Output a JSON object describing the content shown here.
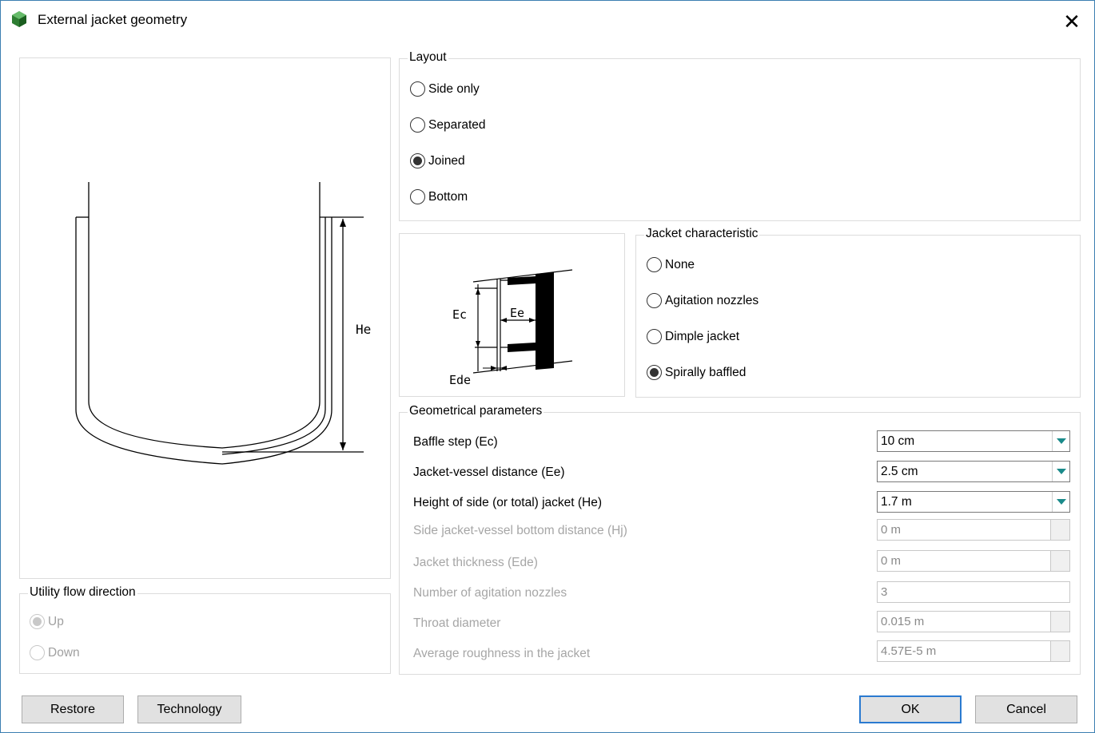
{
  "window": {
    "title": "External jacket geometry",
    "close_glyph": "✕"
  },
  "diagram_main": {
    "label_he": "He"
  },
  "diagram_detail": {
    "label_ec": "Ec",
    "label_ee": "Ee",
    "label_ede": "Ede"
  },
  "layout": {
    "title": "Layout",
    "options": [
      "Side only",
      "Separated",
      "Joined",
      "Bottom"
    ],
    "selected": "Joined"
  },
  "jacket_characteristic": {
    "title": "Jacket characteristic",
    "options": [
      "None",
      "Agitation nozzles",
      "Dimple jacket",
      "Spirally baffled"
    ],
    "selected": "Spirally baffled"
  },
  "utility_flow": {
    "title": "Utility flow direction",
    "options": [
      "Up",
      "Down"
    ],
    "selected": "Up"
  },
  "geometrical": {
    "title": "Geometrical parameters",
    "params": [
      {
        "label": "Baffle step (Ec)",
        "value": "10 cm"
      },
      {
        "label": "Jacket-vessel distance (Ee)",
        "value": "2.5 cm"
      },
      {
        "label": "Height of side (or total) jacket (He)",
        "value": "1.7 m"
      },
      {
        "label": "Side jacket-vessel bottom distance (Hj)",
        "value": "0 m"
      },
      {
        "label": "Jacket thickness (Ede)",
        "value": "0 m"
      },
      {
        "label": "Number of agitation nozzles",
        "value": "3"
      },
      {
        "label": "Throat diameter",
        "value": "0.015 m"
      },
      {
        "label": "Average roughness in the jacket",
        "value": "4.57E-5 m"
      }
    ]
  },
  "buttons": {
    "restore": "Restore",
    "technology": "Technology",
    "ok": "OK",
    "cancel": "Cancel"
  },
  "colors": {
    "accent": "#2a7ad0",
    "dropdown_arrow": "#1a8a8a",
    "disabled_text": "#a6a6a6"
  }
}
